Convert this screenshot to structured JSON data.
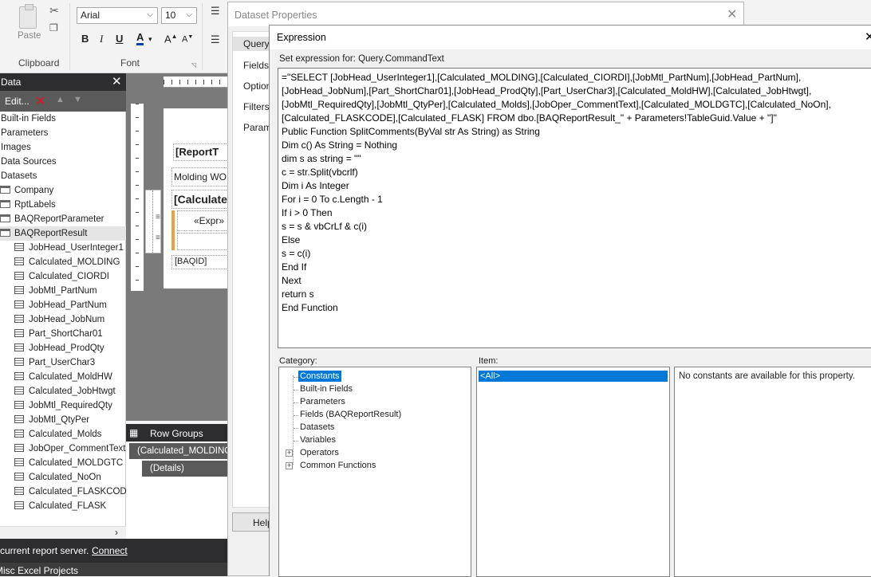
{
  "ribbon": {
    "paste_label": "Paste",
    "clipboard_label": "Clipboard",
    "font_label": "Font",
    "font_name": "Arial",
    "font_size": "10",
    "bold": "B",
    "italic": "I",
    "underline": "U",
    "font_color": "A",
    "grow_font": "A",
    "shrink_font": "A"
  },
  "data_pane": {
    "title": "Data",
    "edit_label": "Edit...",
    "items": [
      {
        "label": "Built-in Fields",
        "level": 0
      },
      {
        "label": "Parameters",
        "level": 0
      },
      {
        "label": "Images",
        "level": 0
      },
      {
        "label": "Data Sources",
        "level": 0
      },
      {
        "label": "Datasets",
        "level": 0
      },
      {
        "label": "Company",
        "level": 1
      },
      {
        "label": "RptLabels",
        "level": 1
      },
      {
        "label": "BAQReportParameter",
        "level": 1
      },
      {
        "label": "BAQReportResult",
        "level": 1
      },
      {
        "label": "JobHead_UserInteger1",
        "level": 2
      },
      {
        "label": "Calculated_MOLDING",
        "level": 2
      },
      {
        "label": "Calculated_CIORDI",
        "level": 2
      },
      {
        "label": "JobMtl_PartNum",
        "level": 2
      },
      {
        "label": "JobHead_PartNum",
        "level": 2
      },
      {
        "label": "JobHead_JobNum",
        "level": 2
      },
      {
        "label": "Part_ShortChar01",
        "level": 2
      },
      {
        "label": "JobHead_ProdQty",
        "level": 2
      },
      {
        "label": "Part_UserChar3",
        "level": 2
      },
      {
        "label": "Calculated_MoldHW",
        "level": 2
      },
      {
        "label": "Calculated_JobHtwgt",
        "level": 2
      },
      {
        "label": "JobMtl_RequiredQty",
        "level": 2
      },
      {
        "label": "JobMtl_QtyPer",
        "level": 2
      },
      {
        "label": "Calculated_Molds",
        "level": 2
      },
      {
        "label": "JobOper_CommentText",
        "level": 2
      },
      {
        "label": "Calculated_MOLDGTC",
        "level": 2
      },
      {
        "label": "Calculated_NoOn",
        "level": 2
      },
      {
        "label": "Calculated_FLASKCODE",
        "level": 2
      },
      {
        "label": "Calculated_FLASK",
        "level": 2
      }
    ]
  },
  "designer": {
    "header_partial": "[ReportT",
    "cell_molding": "Molding WO",
    "cell_calculated": "[Calculate",
    "cell_expr": "«Expr»",
    "cell_baqid": "[BAQID]",
    "row_groups_label": "Row Groups",
    "group_1": "(Calculated_MOLDING",
    "group_2": "(Details)"
  },
  "status": {
    "text": "current report server.",
    "connect_link": "Connect",
    "taskbar_text": "Misc Excel Projects"
  },
  "dataset_dialog": {
    "title": "Dataset Properties",
    "nav": [
      "Query",
      "Fields",
      "Options",
      "Filters",
      "Parameters"
    ],
    "help_label": "Help"
  },
  "expression_dialog": {
    "title": "Expression",
    "set_expression_for": "Set expression for: Query.CommandText",
    "expression_text": "=\"SELECT [JobHead_UserInteger1],[Calculated_MOLDING],[Calculated_CIORDI],[JobMtl_PartNum],[JobHead_PartNum],\n[JobHead_JobNum],[Part_ShortChar01],[JobHead_ProdQty],[Part_UserChar3],[Calculated_MoldHW],[Calculated_JobHtwgt],\n[JobMtl_RequiredQty],[JobMtl_QtyPer],[Calculated_Molds],[JobOper_CommentText],[Calculated_MOLDGTC],[Calculated_NoOn],\n[Calculated_FLASKCODE],[Calculated_FLASK] FROM dbo.[BAQReportResult_\" + Parameters!TableGuid.Value + \"]\"\nPublic Function SplitComments(ByVal str As String) as String\nDim c() As String = Nothing\ndim s as string = \"\"\nc = str.Split(vbcrlf)\nDim i As Integer\nFor i = 0 To c.Length - 1\nIf i > 0 Then\ns = s & vbCrLf & c(i)\nElse\ns = c(i)\nEnd If\nNext\nreturn s\nEnd Function",
    "category_label": "Category:",
    "item_label": "Item:",
    "categories": [
      {
        "label": "Constants",
        "selected": true,
        "expandable": false
      },
      {
        "label": "Built-in Fields",
        "selected": false,
        "expandable": false
      },
      {
        "label": "Parameters",
        "selected": false,
        "expandable": false
      },
      {
        "label": "Fields (BAQReportResult)",
        "selected": false,
        "expandable": false
      },
      {
        "label": "Datasets",
        "selected": false,
        "expandable": false
      },
      {
        "label": "Variables",
        "selected": false,
        "expandable": false
      },
      {
        "label": "Operators",
        "selected": false,
        "expandable": true
      },
      {
        "label": "Common Functions",
        "selected": false,
        "expandable": true
      }
    ],
    "item_selected": "<All>",
    "description": "No constants are available for this property."
  },
  "colors": {
    "accent_selection": "#0078d7",
    "dark_panel": "#2d2d30",
    "delete_red": "#e81123",
    "orange_marker": "#e8a33d"
  }
}
